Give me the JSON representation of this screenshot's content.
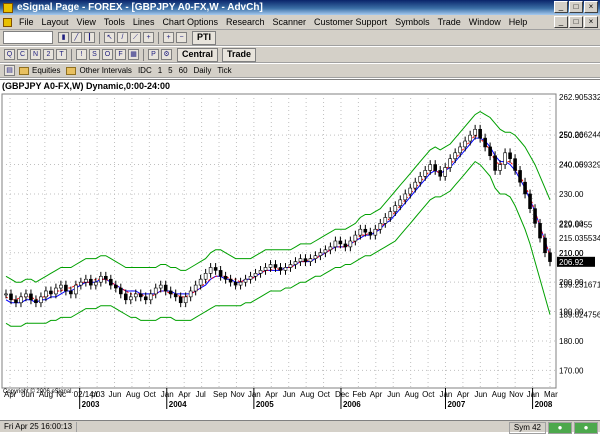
{
  "window": {
    "title": "eSignal Page - FOREX - [GBPJPY A0-FX,W - AdvCh]"
  },
  "menu": [
    "File",
    "Layout",
    "View",
    "Tools",
    "Lines",
    "Chart Options",
    "Research",
    "Scanner",
    "Customer Support",
    "Symbols",
    "Trade",
    "Window",
    "Help"
  ],
  "toolbar2": {
    "central_label": "Central",
    "trade_label": "Trade"
  },
  "toolbar1": {
    "pti_label": "PTI"
  },
  "toolbar3": {
    "equities_label": "Equities",
    "other_intervals_label": "Other Intervals",
    "intervals": [
      "IDC",
      "1",
      "5",
      "60",
      "Daily",
      "Tick"
    ]
  },
  "chart": {
    "label": "(GBPJPY A0-FX,W) Dynamic,0:00-24:00",
    "copyright": "Copyright © 2006 eSignal."
  },
  "status": {
    "time": "Fri Apr 25 16:00:13",
    "sym": "Sym 42"
  },
  "colors": {
    "price": "#000000",
    "upper_band": "#00a000",
    "mid_band": "#0000ff",
    "ma": "#ff0000",
    "grid": "#c0c0c0"
  },
  "chart_data": {
    "type": "line",
    "yaxis_ticks": [
      170.0,
      180.0,
      190.0,
      200.0,
      210.0,
      220.0,
      230.0,
      240.0,
      250.0
    ],
    "price_labels": [
      "262.905332",
      "250.266244",
      "240.059329",
      "219.6455",
      "215.035534",
      "210.00",
      "206.92",
      "199.231671",
      "189.024756"
    ],
    "ylim": [
      164,
      264
    ],
    "xaxis_labels": [
      "Apr",
      "Jun",
      "Aug",
      "Nc",
      "02/14/03",
      "pr",
      "Jun",
      "Aug",
      "Oct",
      "Jan",
      "Apr",
      "Jul",
      "Sep",
      "Nov",
      "Jan",
      "Apr",
      "Jun",
      "Aug",
      "Oct",
      "Dec",
      "Feb",
      "Apr",
      "Jun",
      "Aug",
      "Oct",
      "Jan",
      "Apr",
      "Jun",
      "Aug",
      "Nov",
      "Jan",
      "Mar"
    ],
    "year_labels": [
      "2003",
      "2004",
      "2005",
      "2006",
      "2007",
      "2008"
    ],
    "close": [
      196,
      194,
      193,
      195,
      196,
      194,
      193,
      195,
      197,
      196,
      198,
      199,
      197,
      196,
      199,
      200,
      201,
      199,
      200,
      202,
      201,
      199,
      198,
      196,
      194,
      195,
      196,
      195,
      194,
      196,
      198,
      199,
      197,
      196,
      195,
      193,
      195,
      197,
      199,
      201,
      203,
      205,
      204,
      202,
      201,
      200,
      199,
      200,
      201,
      202,
      203,
      204,
      205,
      206,
      205,
      204,
      205,
      206,
      207,
      208,
      207,
      208,
      209,
      210,
      211,
      212,
      214,
      213,
      212,
      214,
      216,
      218,
      217,
      216,
      218,
      220,
      222,
      224,
      226,
      228,
      230,
      232,
      234,
      236,
      238,
      240,
      238,
      236,
      239,
      242,
      244,
      246,
      248,
      250,
      252,
      249,
      246,
      243,
      238,
      240,
      244,
      242,
      238,
      234,
      230,
      225,
      220,
      215,
      210,
      207
    ],
    "upper_band": [
      202,
      201,
      200,
      200,
      201,
      201,
      200,
      201,
      202,
      203,
      204,
      205,
      205,
      205,
      206,
      207,
      208,
      208,
      208,
      209,
      209,
      208,
      207,
      206,
      205,
      205,
      205,
      205,
      205,
      205,
      205,
      206,
      206,
      205,
      205,
      204,
      204,
      205,
      206,
      207,
      208,
      210,
      211,
      211,
      210,
      209,
      208,
      208,
      208,
      208,
      209,
      210,
      211,
      211,
      211,
      211,
      211,
      211,
      212,
      213,
      213,
      213,
      214,
      215,
      216,
      217,
      218,
      218,
      218,
      219,
      220,
      222,
      223,
      223,
      224,
      225,
      227,
      229,
      231,
      233,
      235,
      237,
      239,
      241,
      243,
      245,
      246,
      245,
      246,
      247,
      249,
      251,
      253,
      255,
      257,
      258,
      257,
      256,
      254,
      252,
      251,
      251,
      250,
      248,
      246,
      243,
      240,
      236,
      232,
      228
    ],
    "lower_band": [
      186,
      185,
      185,
      185,
      186,
      186,
      186,
      186,
      186,
      187,
      187,
      188,
      188,
      188,
      189,
      190,
      191,
      191,
      191,
      192,
      192,
      192,
      191,
      190,
      189,
      188,
      188,
      187,
      187,
      187,
      187,
      188,
      188,
      188,
      187,
      187,
      187,
      187,
      188,
      189,
      190,
      191,
      192,
      192,
      192,
      192,
      192,
      192,
      193,
      193,
      194,
      195,
      196,
      197,
      197,
      197,
      198,
      198,
      199,
      200,
      200,
      201,
      202,
      202,
      203,
      204,
      205,
      205,
      206,
      206,
      207,
      208,
      209,
      209,
      210,
      211,
      212,
      213,
      214,
      216,
      218,
      220,
      222,
      224,
      226,
      228,
      229,
      229,
      230,
      231,
      233,
      235,
      237,
      239,
      241,
      240,
      238,
      236,
      232,
      230,
      230,
      229,
      226,
      222,
      218,
      213,
      207,
      201,
      195,
      189
    ],
    "mid_band": [
      194,
      193,
      193,
      193,
      194,
      194,
      193,
      194,
      194,
      195,
      195,
      196,
      197,
      197,
      198,
      199,
      200,
      200,
      200,
      201,
      201,
      200,
      199,
      198,
      197,
      197,
      197,
      196,
      196,
      196,
      196,
      197,
      197,
      197,
      196,
      196,
      196,
      196,
      197,
      198,
      199,
      201,
      202,
      202,
      201,
      201,
      200,
      200,
      201,
      201,
      202,
      203,
      204,
      204,
      204,
      204,
      205,
      205,
      206,
      207,
      207,
      207,
      208,
      209,
      210,
      211,
      212,
      212,
      212,
      213,
      214,
      215,
      216,
      216,
      217,
      218,
      220,
      221,
      223,
      225,
      227,
      229,
      231,
      233,
      235,
      237,
      238,
      237,
      238,
      239,
      241,
      243,
      245,
      247,
      249,
      249,
      248,
      246,
      243,
      241,
      241,
      240,
      238,
      235,
      232,
      228,
      224,
      219,
      214,
      209
    ],
    "ma": [
      195,
      194,
      194,
      195,
      195,
      195,
      194,
      195,
      195,
      196,
      197,
      197,
      198,
      198,
      199,
      200,
      200,
      200,
      201,
      201,
      201,
      200,
      199,
      198,
      197,
      196,
      196,
      196,
      195,
      195,
      196,
      197,
      197,
      196,
      196,
      195,
      195,
      196,
      197,
      198,
      200,
      201,
      202,
      202,
      202,
      201,
      201,
      200,
      201,
      201,
      202,
      203,
      204,
      204,
      205,
      204,
      205,
      205,
      206,
      207,
      207,
      208,
      208,
      209,
      210,
      211,
      212,
      212,
      212,
      213,
      214,
      216,
      216,
      217,
      217,
      219,
      220,
      222,
      224,
      226,
      228,
      230,
      232,
      234,
      236,
      238,
      238,
      237,
      238,
      240,
      242,
      244,
      246,
      248,
      250,
      249,
      247,
      245,
      241,
      240,
      241,
      241,
      239,
      236,
      233,
      229,
      224,
      219,
      214,
      209
    ]
  }
}
